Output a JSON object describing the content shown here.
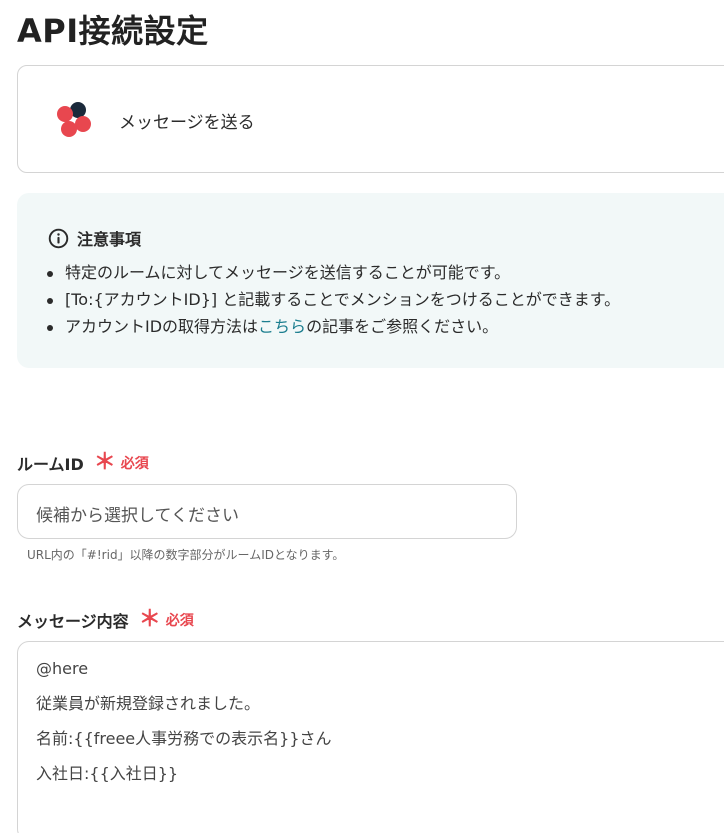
{
  "page": {
    "title": "API接続設定"
  },
  "app_card": {
    "action_label": "メッセージを送る",
    "logo_icon": "chatwork-logo-icon"
  },
  "notice": {
    "title": "注意事項",
    "icon": "info-icon",
    "items": [
      "特定のルームに対してメッセージを送信することが可能です。",
      "[To:{アカウントID}] と記載することでメンションをつけることができます。"
    ],
    "item3": {
      "prefix": "アカウントIDの取得方法は",
      "link": "こちら",
      "suffix": "の記事をご参照ください。"
    }
  },
  "room_id_field": {
    "label": "ルームID",
    "required_mark": "＊",
    "required_text": "必須",
    "placeholder": "候補から選択してください",
    "hint": "URL内の「#!rid」以降の数字部分がルームIDとなります。"
  },
  "message_field": {
    "label": "メッセージ内容",
    "required_mark": "＊",
    "required_text": "必須",
    "lines": [
      "@here",
      "従業員が新規登録されました。",
      "名前:{{freee人事労務での表示名}}さん",
      "入社日:{{入社日}}"
    ]
  },
  "colors": {
    "accent_red": "#e8474f",
    "link_teal": "#1c7e8f",
    "notice_bg": "#f2f8f8"
  }
}
